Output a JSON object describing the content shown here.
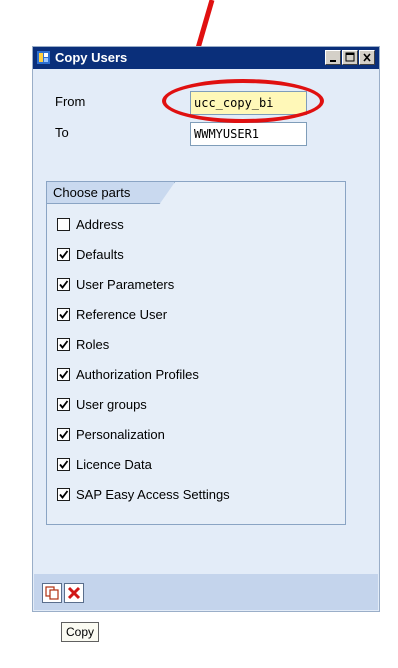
{
  "window": {
    "title": "Copy Users",
    "controls": [
      "minimize",
      "maximize",
      "close"
    ]
  },
  "form": {
    "from_label": "From",
    "from_value": "ucc_copy_bi",
    "to_label": "To",
    "to_value": "WWMYUSER1"
  },
  "parts": {
    "heading": "Choose parts",
    "items": [
      {
        "label": "Address",
        "checked": false
      },
      {
        "label": "Defaults",
        "checked": true
      },
      {
        "label": "User Parameters",
        "checked": true
      },
      {
        "label": "Reference User",
        "checked": true
      },
      {
        "label": "Roles",
        "checked": true
      },
      {
        "label": "Authorization Profiles",
        "checked": true
      },
      {
        "label": "User groups",
        "checked": true
      },
      {
        "label": "Personalization",
        "checked": true
      },
      {
        "label": "Licence Data",
        "checked": true
      },
      {
        "label": "SAP Easy Access Settings",
        "checked": true
      }
    ]
  },
  "toolbar": {
    "copy_icon": "copy-icon",
    "cancel_icon": "cancel-icon",
    "tooltip": "Copy"
  },
  "colors": {
    "annotation": "#e01010",
    "titlebar": "#0a2f7a",
    "highlight_field": "#fff8b8"
  }
}
